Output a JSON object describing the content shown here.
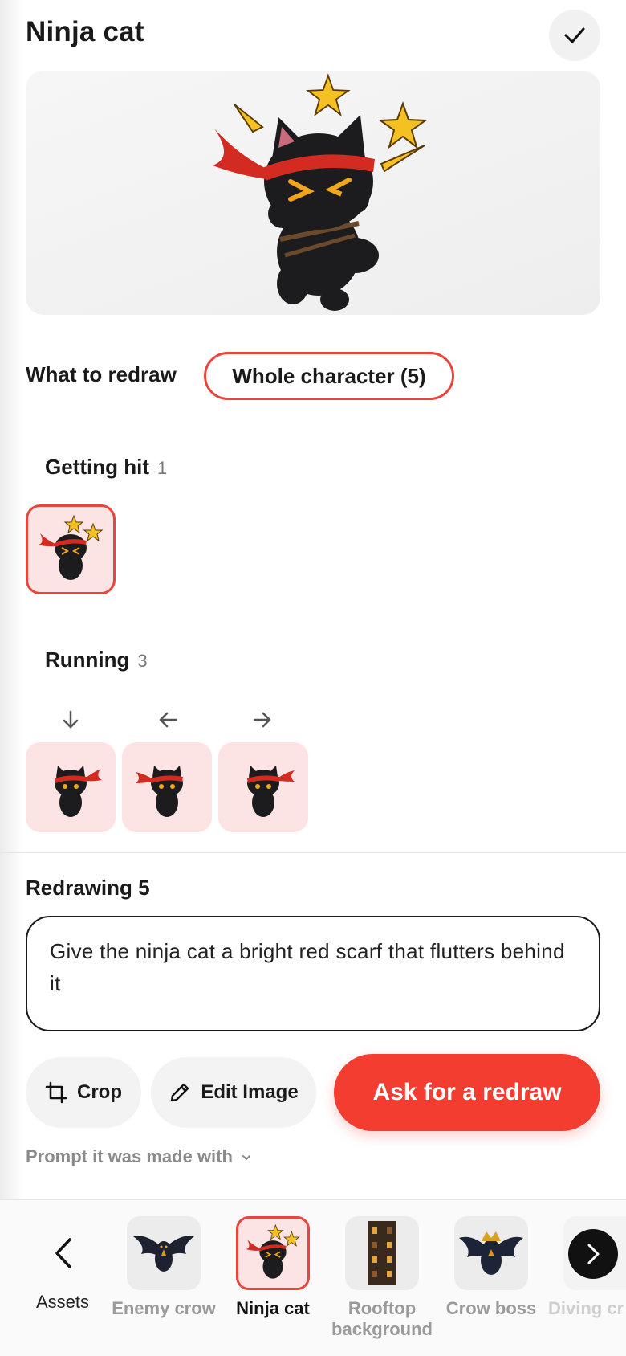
{
  "header": {
    "title": "Ninja cat",
    "done_icon": "check-icon"
  },
  "redraw": {
    "label": "What to redraw",
    "scope": "Whole character (5)"
  },
  "groups": [
    {
      "name": "Getting hit",
      "count": "1"
    },
    {
      "name": "Running",
      "count": "3",
      "directions": [
        "down-arrow-icon",
        "left-arrow-icon",
        "right-arrow-icon"
      ]
    }
  ],
  "redrawing": {
    "title": "Redrawing 5",
    "prompt": "Give the ninja cat a bright red scarf that flutters behind it"
  },
  "actions": {
    "crop": "Crop",
    "edit": "Edit Image",
    "primary": "Ask for a redraw"
  },
  "prompt_disclosure": "Prompt it was made with",
  "bottom_nav": {
    "back_label": "Assets",
    "items": [
      {
        "label": "Enemy crow",
        "icon": "crow-icon",
        "active": false
      },
      {
        "label": "Ninja cat",
        "icon": "ninja-cat-icon",
        "active": true
      },
      {
        "label": "Rooftop background",
        "icon": "building-icon",
        "active": false
      },
      {
        "label": "Crow boss",
        "icon": "crow-boss-icon",
        "active": false
      },
      {
        "label": "Diving cr",
        "icon": "diving-crow-icon",
        "active": false
      }
    ]
  },
  "colors": {
    "accent": "#f23d30",
    "selected_border": "#e8453c",
    "thumb_bg": "#fde4e4"
  }
}
